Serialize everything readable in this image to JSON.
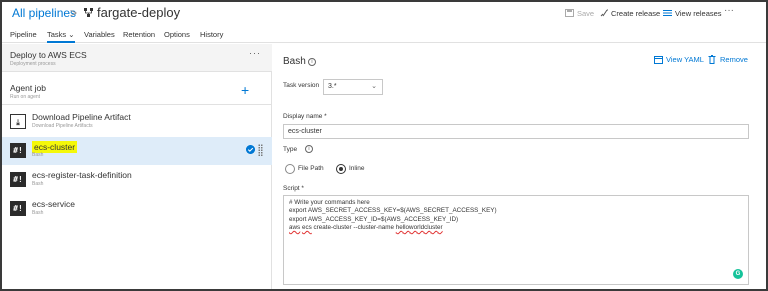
{
  "header": {
    "breadcrumb": "All pipelines",
    "separator": ">",
    "pipeline_name": "fargate-deploy",
    "actions": {
      "save": "Save",
      "create_release": "Create release",
      "view_releases": "View releases",
      "more": "···"
    }
  },
  "tabs": [
    {
      "label": "Pipeline"
    },
    {
      "label": "Tasks ⌄"
    },
    {
      "label": "Variables"
    },
    {
      "label": "Retention"
    },
    {
      "label": "Options"
    },
    {
      "label": "History"
    }
  ],
  "stage": {
    "title": "Deploy to AWS ECS",
    "subtitle": "Deployment process",
    "more": "···"
  },
  "agent_job": {
    "title": "Agent job",
    "subtitle": "Run on agent",
    "add": "+"
  },
  "tasks": [
    {
      "icon": "download-icon",
      "glyph": "⤓",
      "title": "Download Pipeline Artifact",
      "subtitle": "Download Pipeline Artifacts"
    },
    {
      "icon": "bash-icon",
      "glyph": "#!",
      "title": "ecs-cluster",
      "subtitle": "Bash"
    },
    {
      "icon": "bash-icon",
      "glyph": "#!",
      "title": "ecs-register-task-definition",
      "subtitle": "Bash"
    },
    {
      "icon": "bash-icon",
      "glyph": "#!",
      "title": "ecs-service",
      "subtitle": "Bash"
    }
  ],
  "panel": {
    "title": "Bash",
    "view_yaml": "View YAML",
    "remove": "Remove",
    "task_version_label": "Task version",
    "task_version_value": "3.*",
    "display_name_label": "Display name *",
    "display_name_value": "ecs-cluster",
    "type_label": "Type",
    "type_options": [
      "File Path",
      "Inline"
    ],
    "type_selected": "Inline",
    "script_label": "Script *",
    "script_lines": [
      "# Write your commands here",
      "export AWS_SECRET_ACCESS_KEY=$(AWS_SECRET_ACCESS_KEY)",
      "export AWS_ACCESS_KEY_ID=$(AWS_ACCESS_KEY_ID)"
    ],
    "script_last": {
      "aws": "aws",
      "ecs": "ecs",
      "mid": " create-cluster --cluster-name ",
      "name": "helloworldcluster"
    },
    "grammar_badge": "G"
  },
  "colors": {
    "accent": "#0078d4",
    "selected_row": "#deecf9",
    "highlight": "#f4f80a"
  }
}
